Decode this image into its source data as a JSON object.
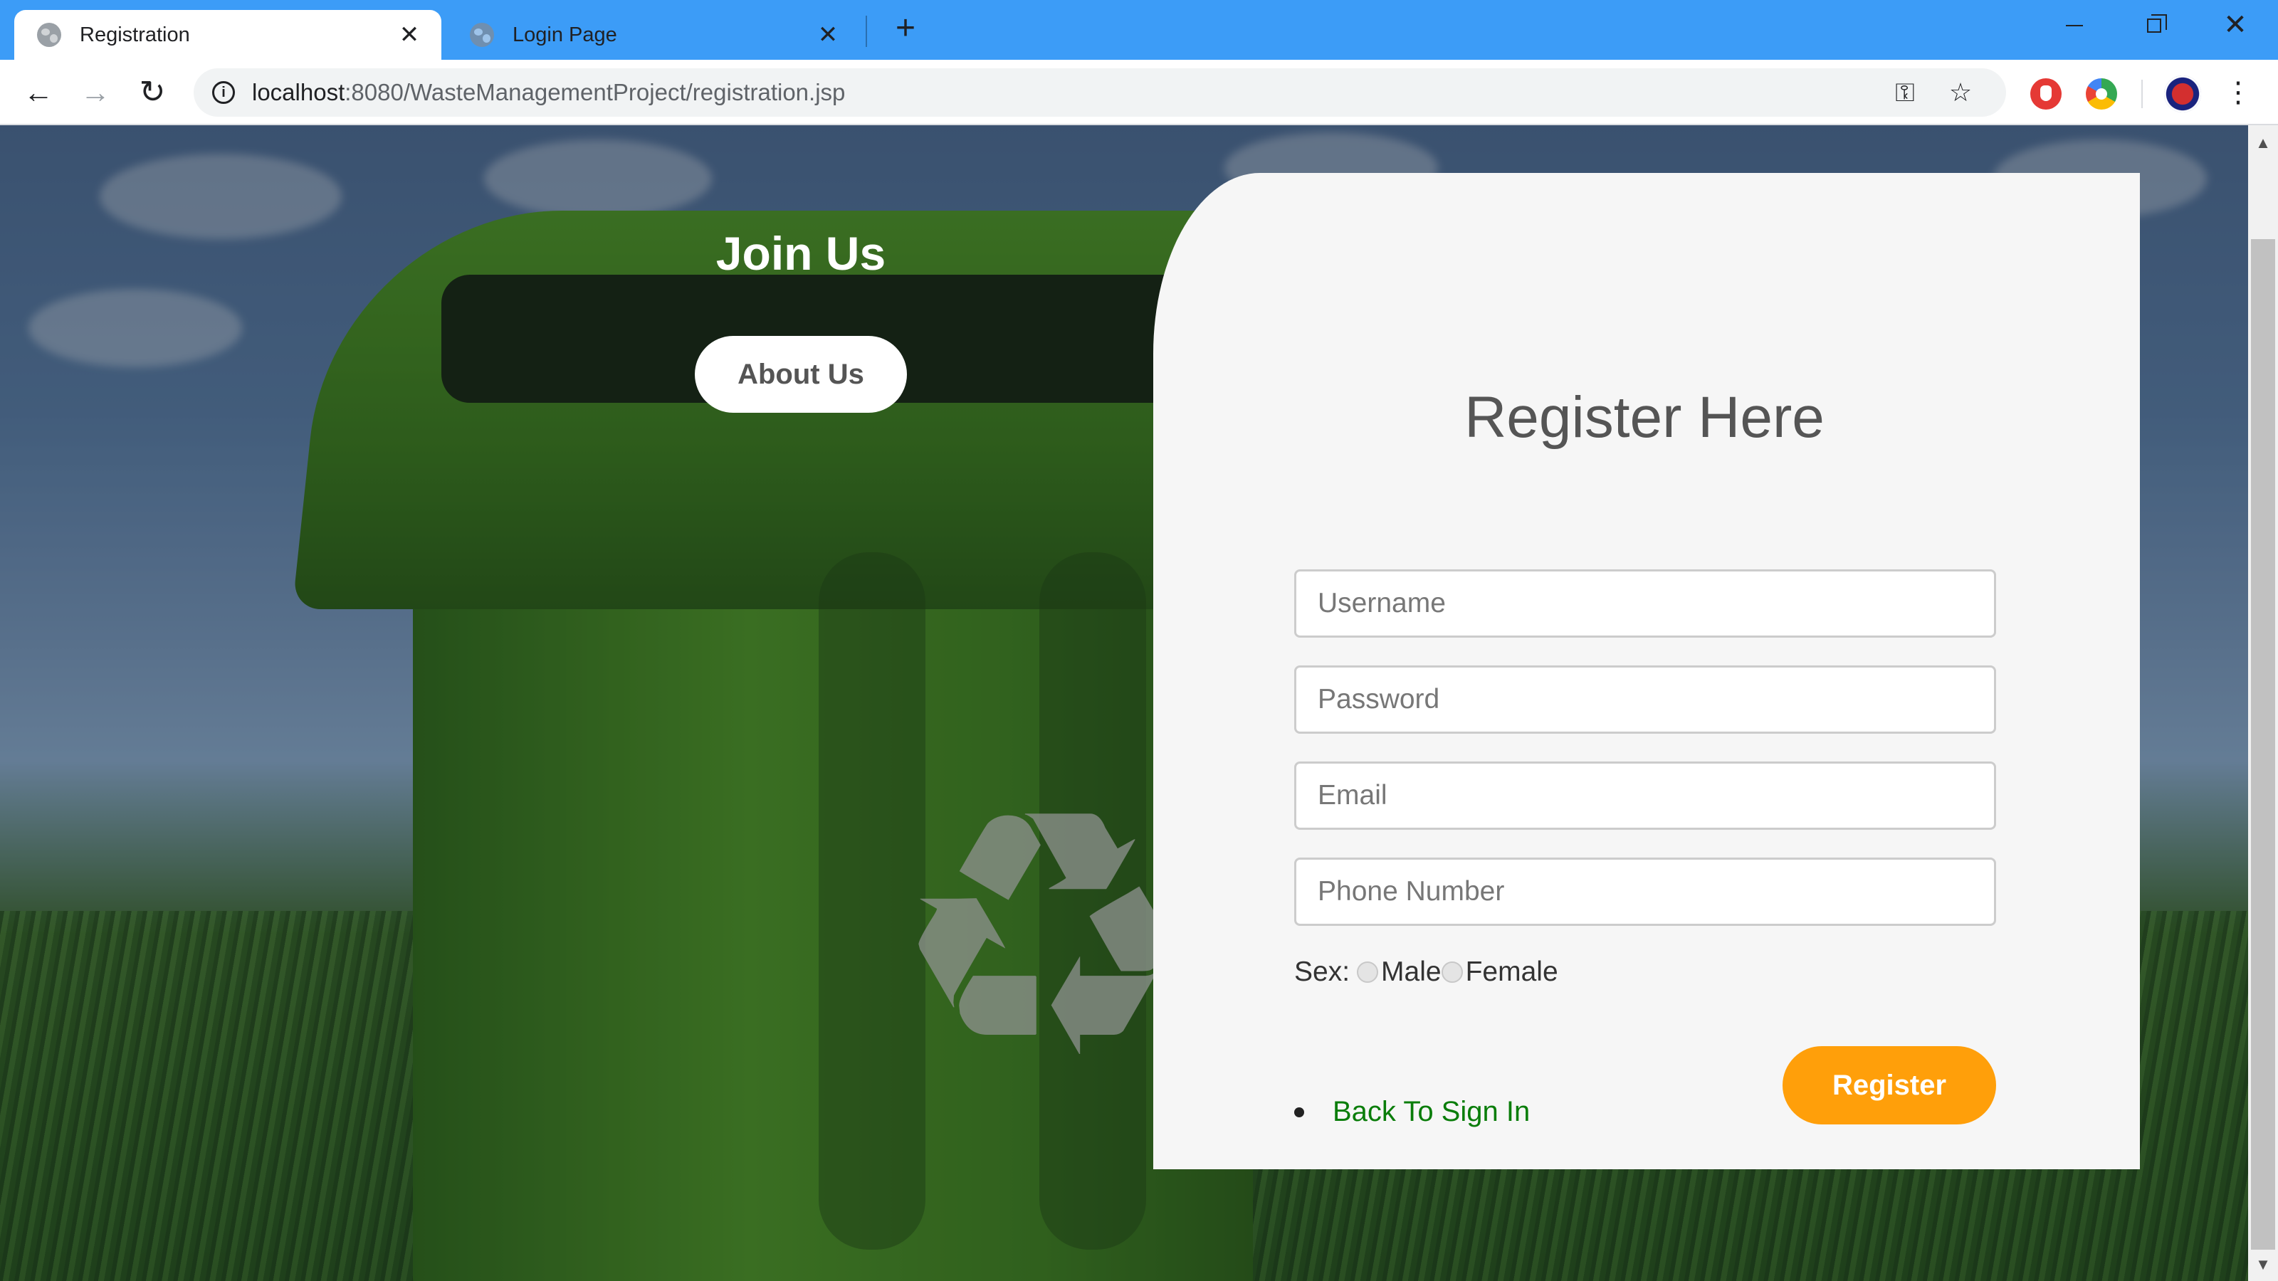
{
  "browser": {
    "tabs": [
      {
        "title": "Registration",
        "active": true
      },
      {
        "title": "Login Page",
        "active": false
      }
    ],
    "url_host": "localhost",
    "url_rest": ":8080/WasteManagementProject/registration.jsp",
    "icons": {
      "back": "←",
      "forward": "→",
      "reload": "↻",
      "close": "✕",
      "new_tab": "+",
      "key": "⚿",
      "star": "☆",
      "menu": "⋮",
      "info": "i",
      "scroll_up": "▲",
      "scroll_down": "▼"
    }
  },
  "hero": {
    "title": "Join Us",
    "about_button": "About Us",
    "recycle_glyph": "♻"
  },
  "form": {
    "title": "Register Here",
    "username_placeholder": "Username",
    "password_placeholder": "Password",
    "email_placeholder": "Email",
    "phone_placeholder": "Phone Number",
    "sex_label": "Sex:",
    "male_label": "Male",
    "female_label": "Female",
    "register_button": "Register",
    "back_link": "Back To Sign In"
  },
  "colors": {
    "tab_strip": "#3c9cf7",
    "register_button": "#ff9f0a",
    "link": "#0a7d0a",
    "card": "#f6f6f6"
  }
}
